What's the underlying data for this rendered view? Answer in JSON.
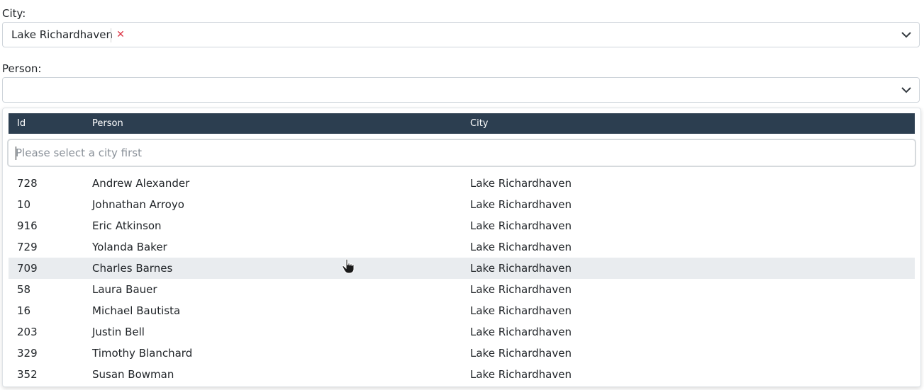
{
  "city": {
    "label": "City:",
    "selected": "Lake Richardhaven",
    "remove_icon": "close-icon",
    "remove_color": "#dc3545"
  },
  "person": {
    "label": "Person:",
    "value": ""
  },
  "dropdown": {
    "columns": {
      "id": "Id",
      "person": "Person",
      "city": "City"
    },
    "header_color": "#2c3e50",
    "search_placeholder": "Please select a city first",
    "hover_row_index": 4,
    "rows": [
      {
        "id": "728",
        "person": "Andrew Alexander",
        "city": "Lake Richardhaven"
      },
      {
        "id": "10",
        "person": "Johnathan Arroyo",
        "city": "Lake Richardhaven"
      },
      {
        "id": "916",
        "person": "Eric Atkinson",
        "city": "Lake Richardhaven"
      },
      {
        "id": "729",
        "person": "Yolanda Baker",
        "city": "Lake Richardhaven"
      },
      {
        "id": "709",
        "person": "Charles Barnes",
        "city": "Lake Richardhaven"
      },
      {
        "id": "58",
        "person": "Laura Bauer",
        "city": "Lake Richardhaven"
      },
      {
        "id": "16",
        "person": "Michael Bautista",
        "city": "Lake Richardhaven"
      },
      {
        "id": "203",
        "person": "Justin Bell",
        "city": "Lake Richardhaven"
      },
      {
        "id": "329",
        "person": "Timothy Blanchard",
        "city": "Lake Richardhaven"
      },
      {
        "id": "352",
        "person": "Susan Bowman",
        "city": "Lake Richardhaven"
      }
    ]
  }
}
